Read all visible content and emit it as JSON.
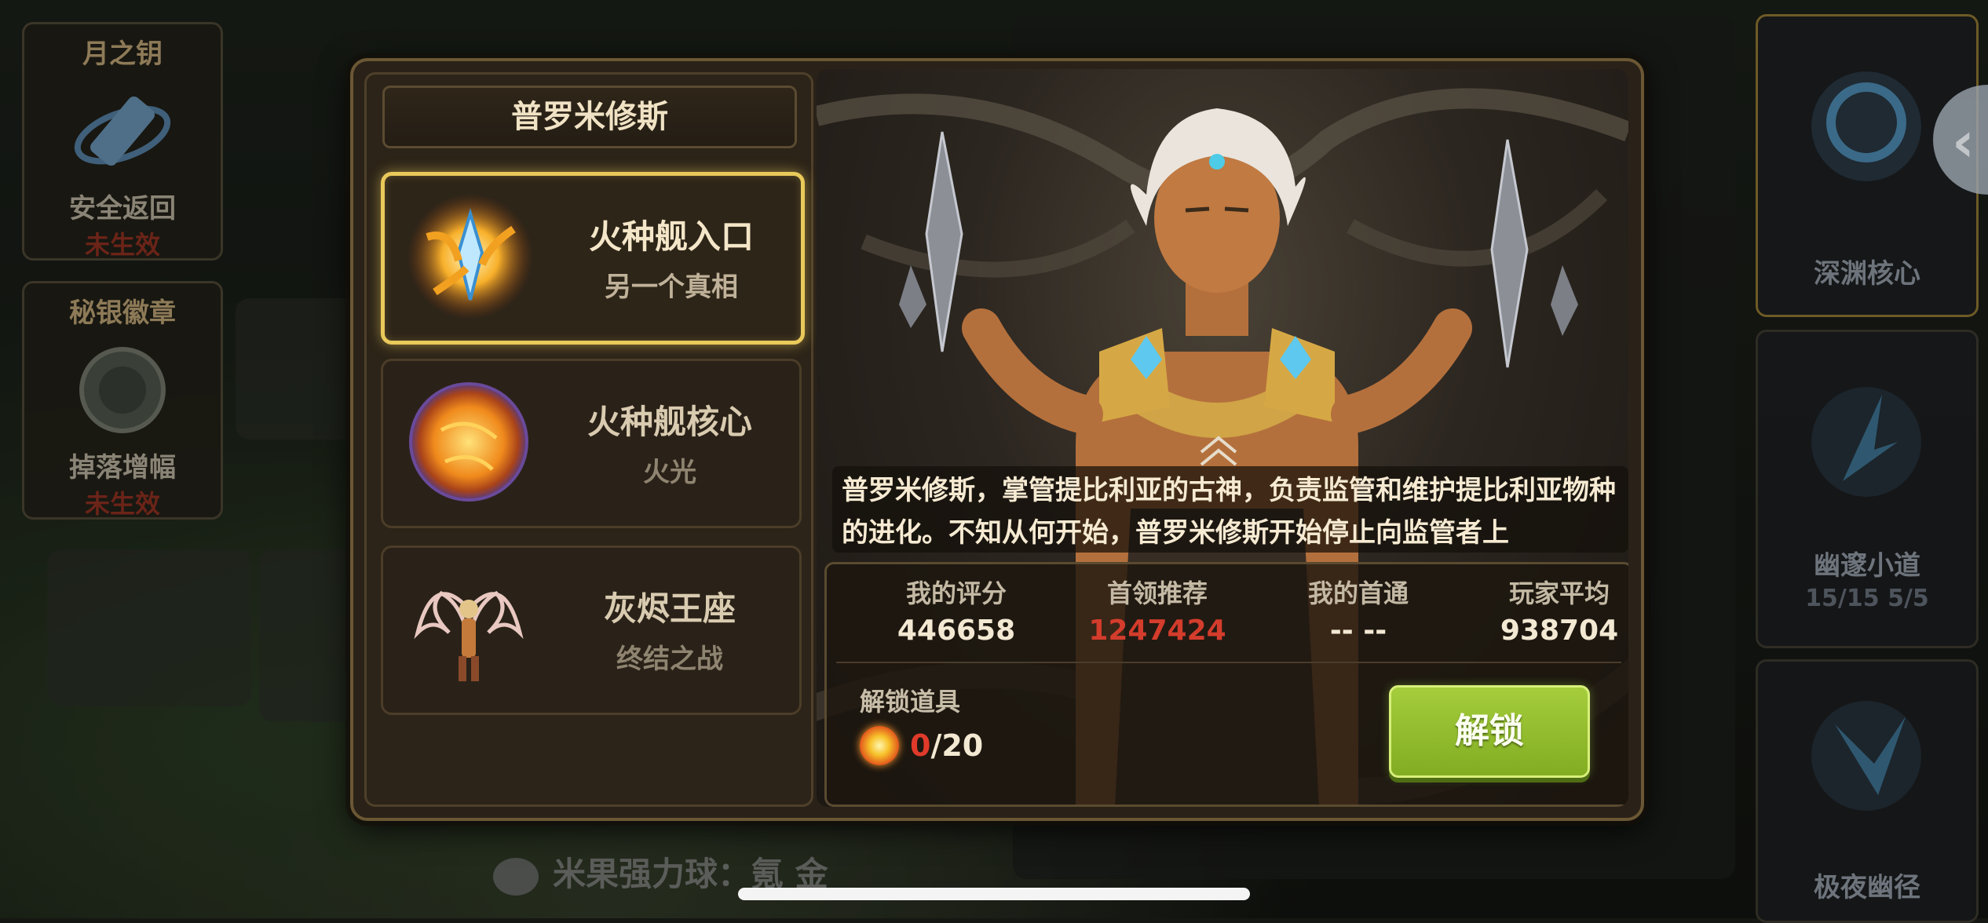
{
  "left_buffs": [
    {
      "title": "月之钥",
      "label": "安全返回",
      "state": "未生效"
    },
    {
      "title": "秘银徽章",
      "label": "掉落增幅",
      "state": "未生效"
    }
  ],
  "right_dungeons": [
    {
      "name": "深渊核心",
      "sub": ""
    },
    {
      "name": "幽邃小道",
      "sub": "15/15  5/5"
    },
    {
      "name": "极夜幽径",
      "sub": ""
    }
  ],
  "chat": {
    "text": "米果强力球：氪 金"
  },
  "modal": {
    "header": "普罗米修斯",
    "items": [
      {
        "name": "火种舰入口",
        "desc": "另一个真相",
        "icon": "fire-crystal-icon"
      },
      {
        "name": "火种舰核心",
        "desc": "火光",
        "icon": "fire-sphere-icon"
      },
      {
        "name": "灰烬王座",
        "desc": "终结之战",
        "icon": "winged-boss-icon"
      }
    ],
    "description": "普罗米修斯，掌管提比利亚的古神，负责监管和维护提比利亚物种的进化。不知从何开始，普罗米修斯开始停止向监管者上",
    "stats": [
      {
        "label": "我的评分",
        "value": "446658",
        "color": "normal"
      },
      {
        "label": "首领推荐",
        "value": "1247424",
        "color": "red"
      },
      {
        "label": "我的首通",
        "value": "-- --",
        "color": "normal"
      },
      {
        "label": "玩家平均",
        "value": "938704",
        "color": "normal"
      }
    ],
    "unlock": {
      "label": "解锁道具",
      "have": "0",
      "need": "/20",
      "button": "解锁"
    }
  },
  "colors": {
    "selected_border": "#e9c95a",
    "unlock_button": "#9cc436",
    "warning_red": "#d43c2c"
  }
}
